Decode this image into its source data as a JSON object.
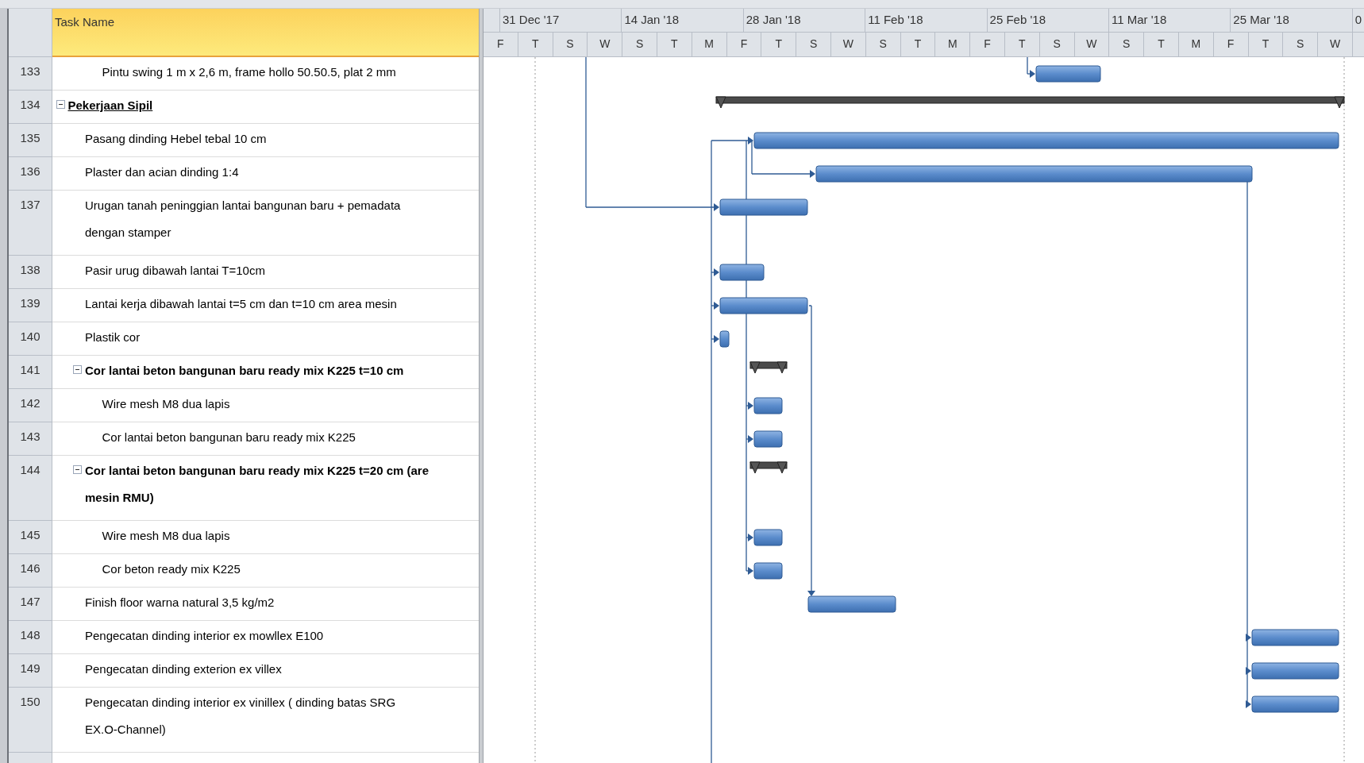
{
  "table": {
    "task_name_heading": "Task Name"
  },
  "timeline": {
    "weeks": [
      "31 Dec '17",
      "14 Jan '18",
      "28 Jan '18",
      "11 Feb '18",
      "25 Feb '18",
      "11 Mar '18",
      "25 Mar '18",
      "0"
    ],
    "days": [
      "F",
      "T",
      "S",
      "W",
      "S",
      "T",
      "M",
      "F",
      "T",
      "S",
      "W",
      "S",
      "T",
      "M",
      "F",
      "T",
      "S",
      "W",
      "S",
      "T",
      "M",
      "F",
      "T",
      "S",
      "W"
    ]
  },
  "tasks": [
    {
      "children": [
        {
          "children": [
            {
              "id": "133",
              "lines": [
                "Pintu swing 1 m x 2,6 m, frame hollo 50.50.5, plat 2 mm"
              ],
              "summary": false,
              "underline": false
            }
          ]
        }
      ]
    },
    {
      "id": "134",
      "lines": [
        "Pekerjaan Sipil"
      ],
      "summary": true,
      "underline": true,
      "children": [
        {
          "id": "135",
          "lines": [
            "Pasang dinding Hebel tebal 10 cm"
          ],
          "summary": false,
          "underline": false
        },
        {
          "id": "136",
          "lines": [
            "Plaster dan acian dinding 1:4"
          ],
          "summary": false,
          "underline": false
        },
        {
          "id": "137",
          "lines": [
            "Urugan tanah peninggian lantai bangunan baru + pemadata",
            "dengan stamper"
          ],
          "summary": false,
          "underline": false
        },
        {
          "id": "138",
          "lines": [
            "Pasir urug dibawah lantai T=10cm"
          ],
          "summary": false,
          "underline": false
        },
        {
          "id": "139",
          "lines": [
            "Lantai kerja dibawah lantai t=5 cm dan t=10 cm area mesin"
          ],
          "summary": false,
          "underline": false
        },
        {
          "id": "140",
          "lines": [
            "Plastik cor"
          ],
          "summary": false,
          "underline": false
        },
        {
          "id": "141",
          "lines": [
            "Cor lantai beton bangunan baru ready mix K225 t=10 cm"
          ],
          "summary": true,
          "underline": false,
          "children": [
            {
              "id": "142",
              "lines": [
                "Wire mesh M8 dua lapis"
              ],
              "summary": false,
              "underline": false
            },
            {
              "id": "143",
              "lines": [
                "Cor lantai beton bangunan baru ready mix K225"
              ],
              "summary": false,
              "underline": false
            }
          ]
        },
        {
          "id": "144",
          "lines": [
            "Cor lantai beton bangunan baru ready mix K225 t=20 cm (are",
            "mesin RMU)"
          ],
          "summary": true,
          "underline": false,
          "children": [
            {
              "id": "145",
              "lines": [
                "Wire mesh M8 dua lapis"
              ],
              "summary": false,
              "underline": false
            },
            {
              "id": "146",
              "lines": [
                "Cor beton ready mix K225"
              ],
              "summary": false,
              "underline": false
            }
          ]
        },
        {
          "id": "147",
          "lines": [
            "Finish floor warna natural 3,5 kg/m2"
          ],
          "summary": false,
          "underline": false
        },
        {
          "id": "148",
          "lines": [
            "Pengecatan dinding interior ex mowllex E100"
          ],
          "summary": false,
          "underline": false
        },
        {
          "id": "149",
          "lines": [
            "Pengecatan dinding exterion ex villex"
          ],
          "summary": false,
          "underline": false
        },
        {
          "id": "150",
          "lines": [
            "Pengecatan dinding interior ex vinillex ( dinding batas SRG",
            "EX.O-Channel)"
          ],
          "summary": false,
          "underline": false
        }
      ]
    }
  ]
}
